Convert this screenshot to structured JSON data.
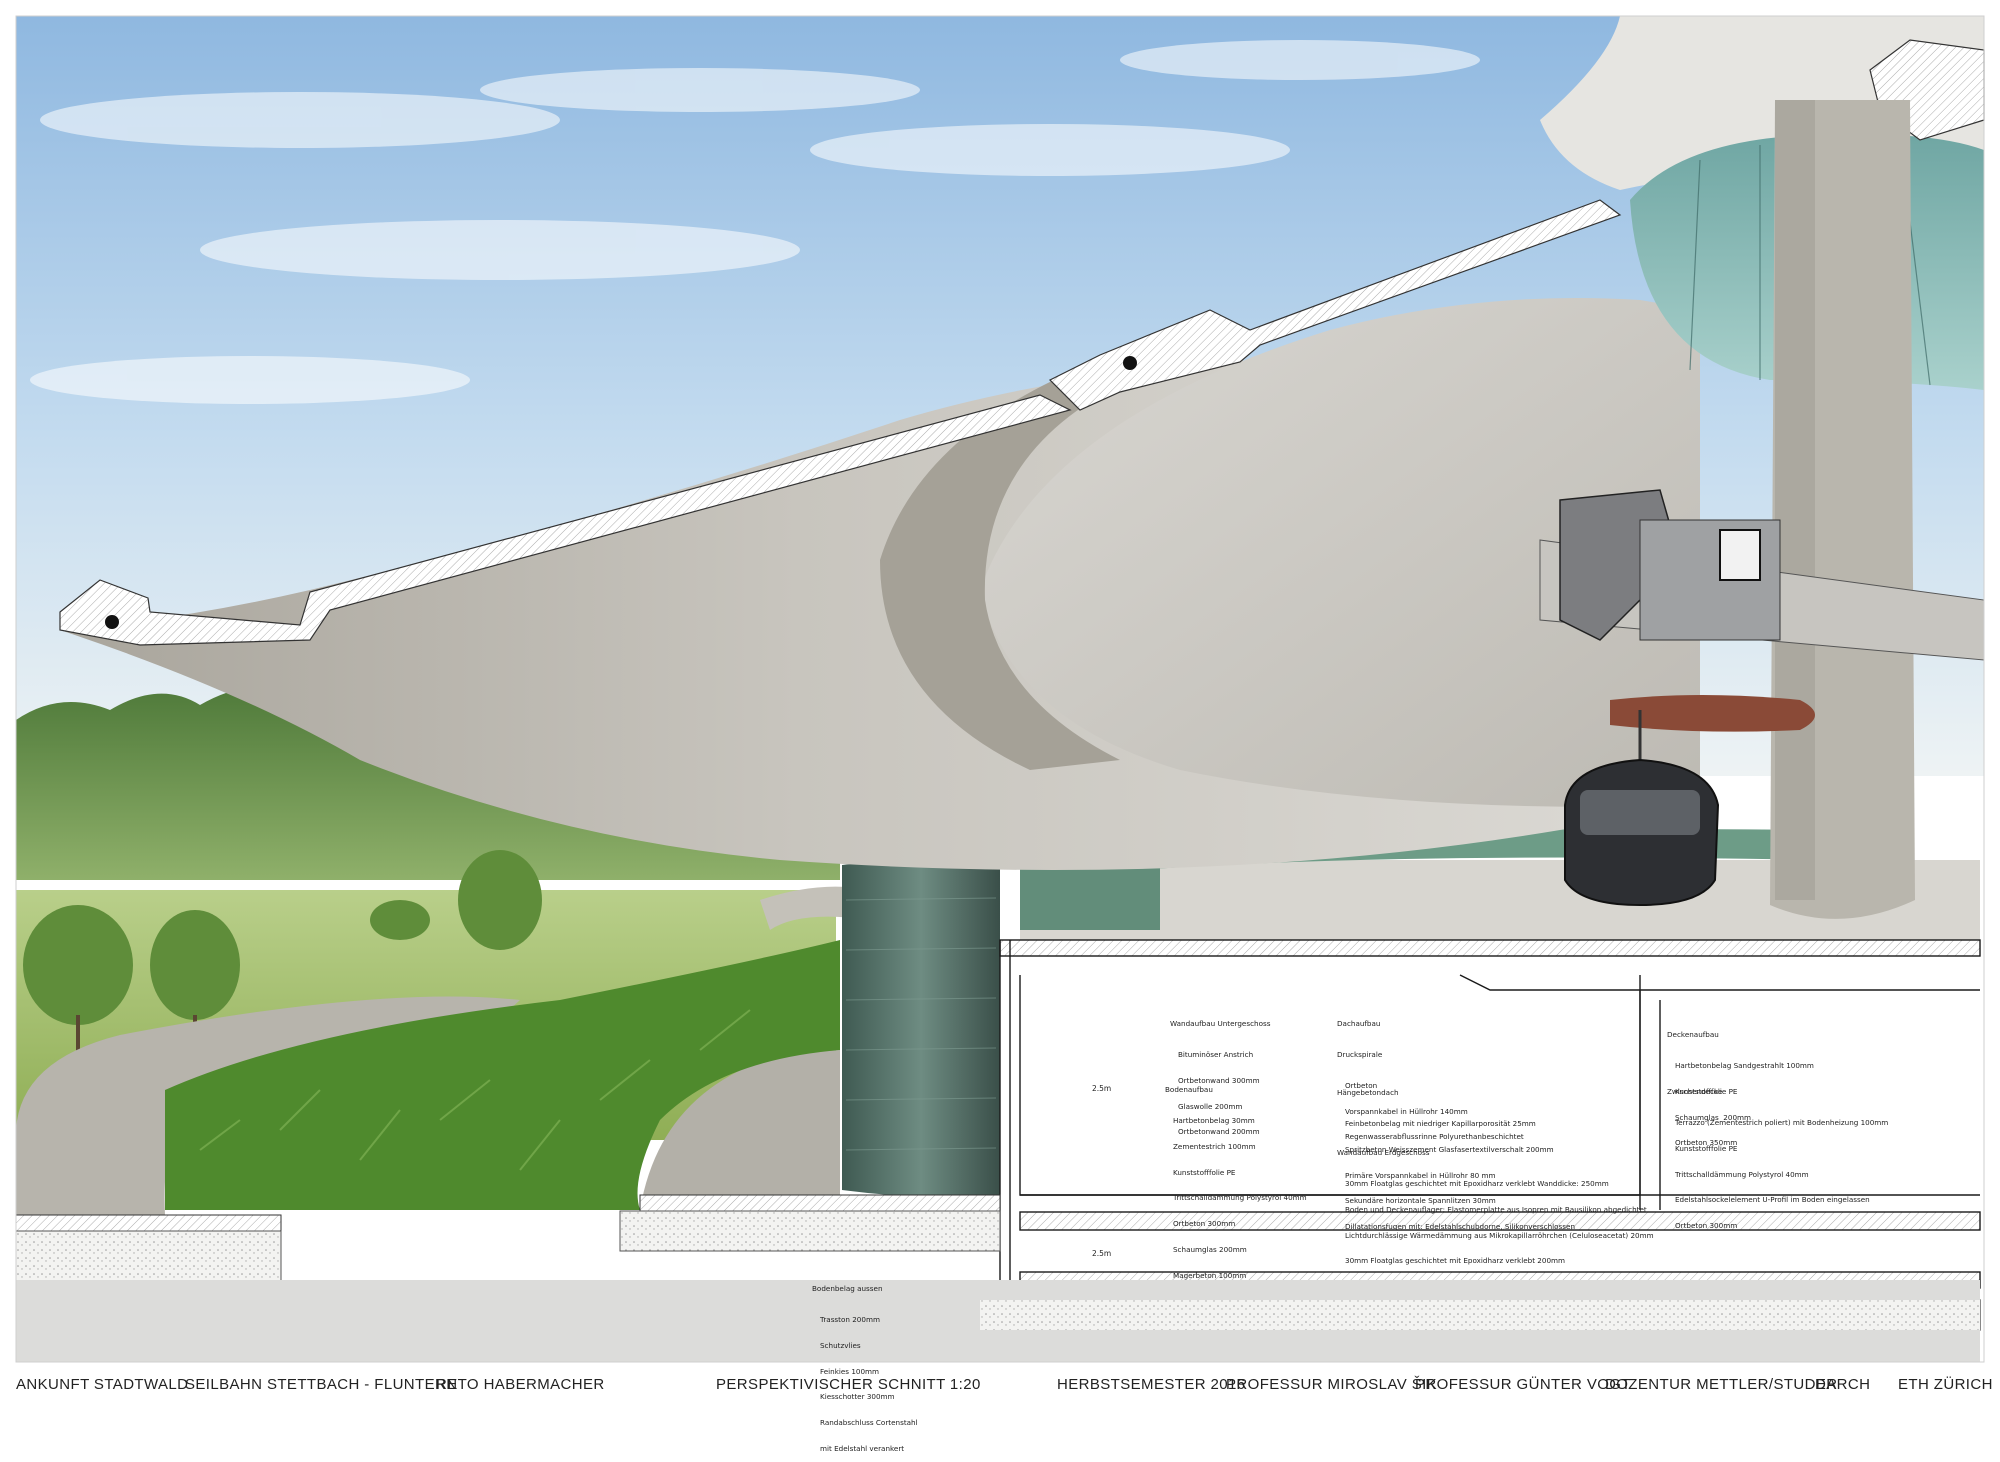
{
  "colors": {
    "sky_top": "#9fc4e6",
    "sky_bottom": "#e6f0f6",
    "concrete": "#c9c6bf",
    "concrete_shadow": "#9d998f",
    "glass": "#9ec9c8",
    "greenery": "#5e8f3a",
    "section_line": "#1a1a1a"
  },
  "spec": {
    "wall_lower": {
      "heading": "Wandaufbau Untergeschoss",
      "items": [
        "Bituminöser Anstrich",
        "Ortbetonwand 300mm",
        "Glaswolle 200mm",
        "Ortbetonwand 200mm"
      ]
    },
    "floor": {
      "heading": "Bodenaufbau",
      "items": [
        "Hartbetonbelag 30mm",
        "Zementestrich 100mm",
        "Kunststofffolie PE",
        "Trittschalldämmung Polystyrol 40mm",
        "Ortbeton 300mm",
        "Schaumglas 200mm",
        "Magerbeton 100mm"
      ]
    },
    "roof": {
      "heading": "Dachaufbau",
      "sub": "Druckspirale",
      "items": [
        "Ortbeton",
        "Vorspannkabel in Hüllrohr 140mm",
        "Regenwasserabflussrinne Polyurethanbeschichtet"
      ]
    },
    "hanging_roof": {
      "heading": "Hängebetondach",
      "items": [
        "Feinbetonbelag mit niedriger Kapillarporosität 25mm",
        "Spritzbeton Weisszement Glasfasertextilverschalt 200mm",
        "Primäre Vorspannkabel in Hüllrohr 80 mm",
        "Sekundäre horizontale Spannlitzen 30mm",
        "Dillatationsfugen mit: Edelstahlschubdorne, Silikonverschlossen"
      ]
    },
    "wall_ground": {
      "heading": "Wandaufbau Erdgeschoss",
      "items": [
        "30mm Floatglas geschichtet mit Epoxidharz verklebt Wanddicke: 250mm",
        "Boden und Deckenauflager: Elastomerplatte aus Isopren mit Bausilikon abgedichtet",
        "Lichtdurchlässige Wärmedämmung aus Mikrokapillarröhrchen (Celuloseacetat) 20mm",
        "30mm Floatglas geschichtet mit Epoxidharz verklebt 200mm"
      ]
    },
    "ceiling": {
      "heading": "Deckenaufbau",
      "items": [
        "Hartbetonbelag Sandgestrahlt 100mm",
        "Kunststofffolie PE",
        "Schaumglas  200mm",
        "Ortbeton 350mm"
      ]
    },
    "intermediate": {
      "heading": "Zwischendecke",
      "items": [
        "Terrazzo (Zementestrich poliert) mit Bodenheizung 100mm",
        "Kunststofffolie PE",
        "Trittschalldämmung Polystyrol 40mm",
        "Edelstahlsockelelement U-Profil im Boden eingelassen",
        "Ortbeton 300mm"
      ]
    },
    "exterior_floor": {
      "heading": "Bodenbelag aussen",
      "items": [
        "Trasston 200mm",
        "Schutzvlies",
        "Feinkies 100mm",
        "Kiesschotter 300mm",
        "Randabschluss Cortenstahl",
        "mit Edelstahl verankert"
      ]
    }
  },
  "dimensions": {
    "height_upper": "2.5m",
    "height_lower": "2.5m"
  },
  "footer": [
    "ANKUNFT STADTWALD",
    "SEILBAHN STETTBACH - FLUNTERN",
    "RETO HABERMACHER",
    "PERSPEKTIVISCHER SCHNITT 1:20",
    "HERBSTSEMESTER 2016",
    "PROFESSUR MIROSLAV ŠIK",
    "PROFESSUR GÜNTER VOGT",
    "DOZENTUR METTLER/STUDER",
    "DARCH",
    "ETH ZÜRICH"
  ]
}
